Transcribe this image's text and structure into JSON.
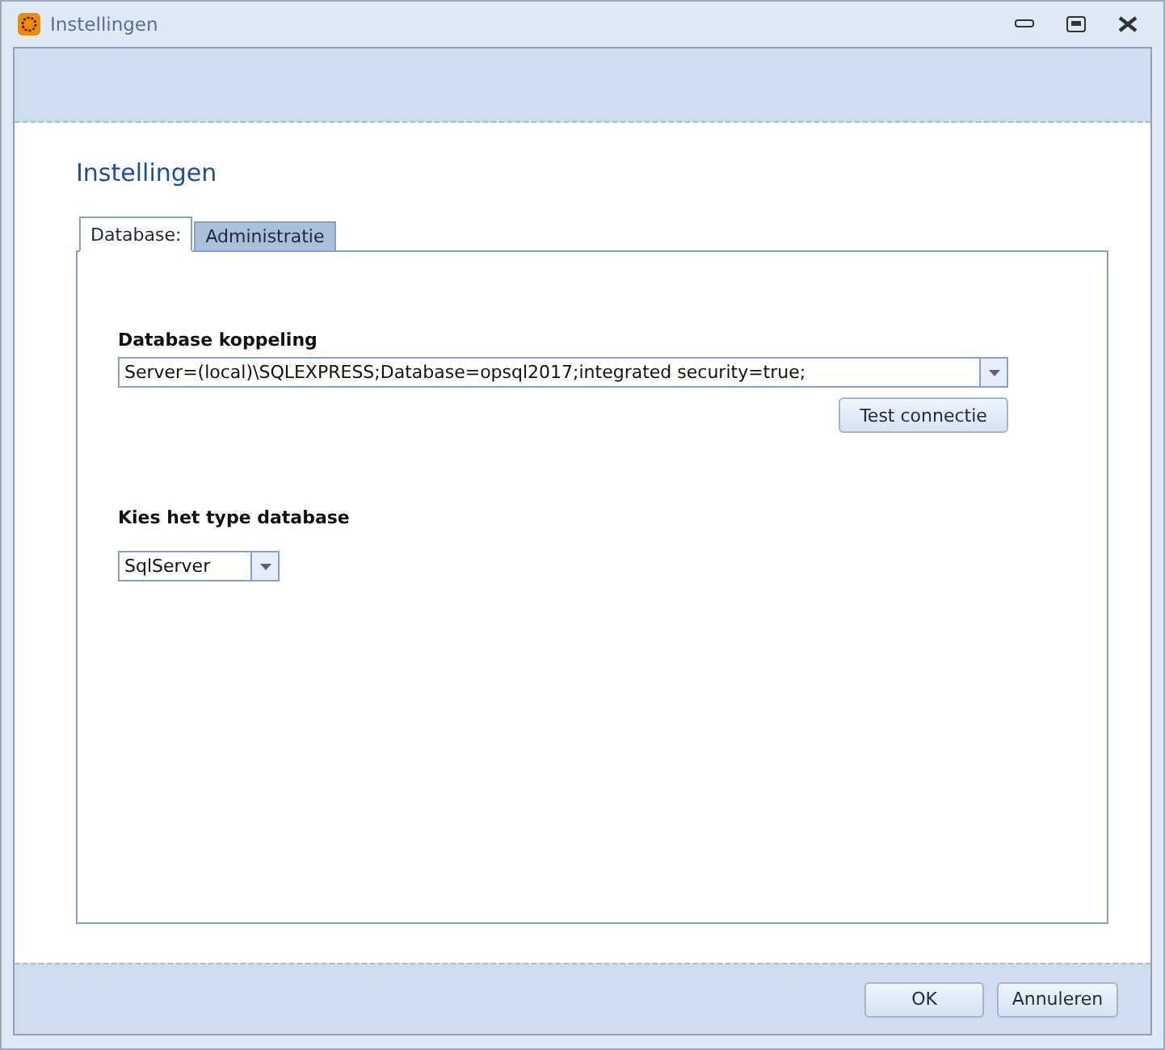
{
  "window": {
    "title": "Instellingen"
  },
  "heading": "Instellingen",
  "tabs": [
    {
      "label": "Database:",
      "selected": true
    },
    {
      "label": "Administratie",
      "selected": false
    }
  ],
  "database_link": {
    "label": "Database koppeling",
    "value": "Server=(local)\\SQLEXPRESS;Database=opsql2017;integrated security=true;",
    "button": "Test connectie"
  },
  "database_type": {
    "label": "Kies het type database",
    "value": "SqlServer"
  },
  "buttons": [
    "OK",
    "Annuleren"
  ]
}
